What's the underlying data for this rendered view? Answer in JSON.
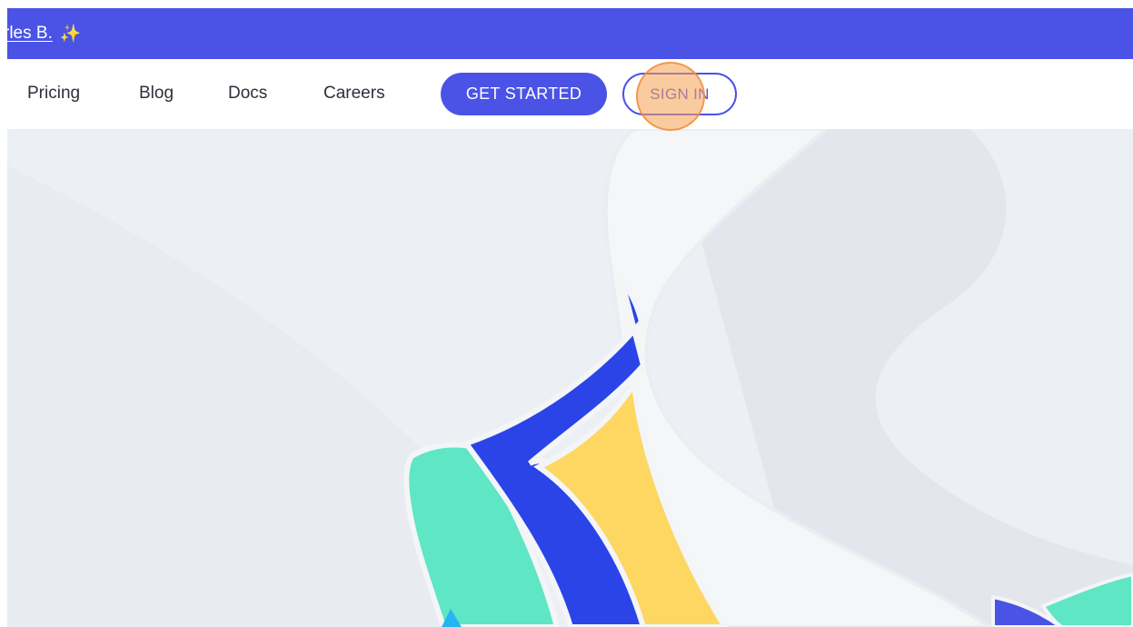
{
  "announcement": {
    "link_text": "rles B.",
    "icon": "sparkle-icon",
    "icon_glyph": "✨",
    "background_color": "#4a53e6"
  },
  "nav": {
    "items": [
      {
        "label": "Pricing"
      },
      {
        "label": "Blog"
      },
      {
        "label": "Docs"
      },
      {
        "label": "Careers"
      }
    ],
    "get_started_label": "GET STARTED",
    "sign_in_label": "SIGN IN",
    "accent_color": "#4a53e6"
  },
  "hero": {
    "colors": {
      "background": "#eceff3",
      "blue": "#2b44e8",
      "yellow": "#fdd761",
      "green": "#5fe6c4",
      "cyan": "#26b5f2",
      "light": "#f5f6f7"
    }
  },
  "click_indicator": {
    "color": "#f7a052"
  }
}
